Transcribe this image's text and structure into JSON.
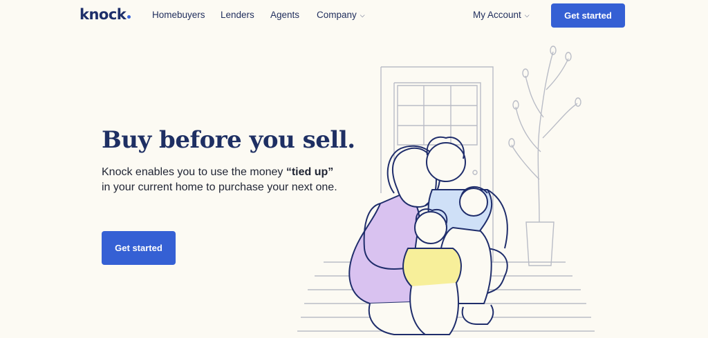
{
  "brand": {
    "logo_text": "knock",
    "accent": "#3560d4",
    "ink": "#1e2f63"
  },
  "nav": {
    "links": [
      {
        "label": "Homebuyers"
      },
      {
        "label": "Lenders"
      },
      {
        "label": "Agents"
      },
      {
        "label": "Company",
        "icon": "chevron-down-icon"
      }
    ],
    "account_label": "My Account",
    "cta_label": "Get started"
  },
  "hero": {
    "title": "Buy before you sell.",
    "text_before": "Knock enables you to use the money ",
    "text_bold": "“tied up”",
    "text_after": " in your current home to purchase your next one.",
    "cta_label": "Get started"
  },
  "colors": {
    "background": "#fcfaf3",
    "dress": "#d9c2f0",
    "shirt_blue": "#cfe0f7",
    "shirt_yellow": "#f7ef9a",
    "line": "#1f2d6b",
    "sketch": "#b9bcc6"
  }
}
